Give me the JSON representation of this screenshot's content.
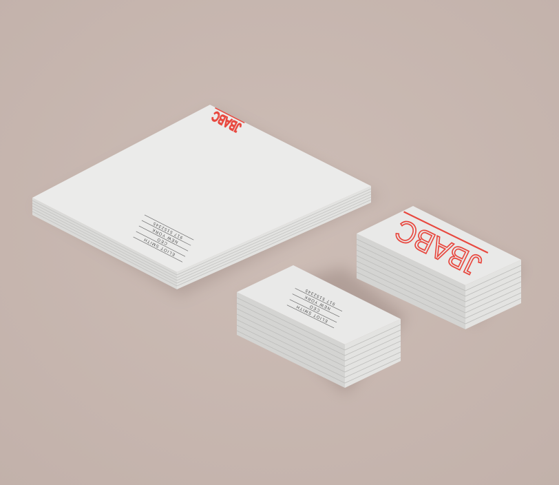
{
  "colors": {
    "background": "#c9b8b1",
    "paper": "#e9e9e8",
    "paper_edge": "#d6d6d4",
    "accent": "#e8483f"
  },
  "letterhead": {
    "logo": "JBABC",
    "name": "ELIOT SMITH",
    "role": "CEO",
    "city": "NEW YORK",
    "phone": "917 5152345"
  },
  "card_back": {
    "name": "ELIOT SMITH",
    "role": "CEO",
    "city": "NEW YORK",
    "phone": "917 5152345"
  },
  "card_front": {
    "logo": "JBABC"
  }
}
